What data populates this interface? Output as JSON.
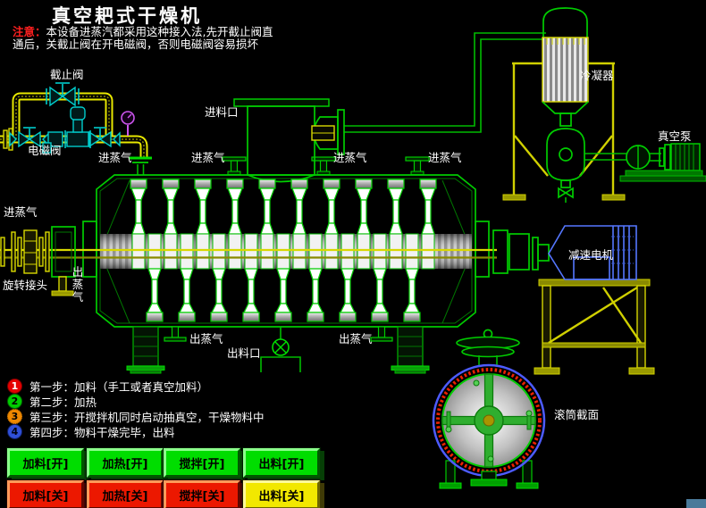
{
  "title": "真空耙式干燥机",
  "note": {
    "prefix": "注意：",
    "line1": "本设备进蒸汽都采用这种接入法,先开截止阀直",
    "line2": "通后，关截止阀在开电磁阀，否则电磁阀容易损坏"
  },
  "labels": {
    "stop_valve": "截止阀",
    "solenoid_valve": "电磁阀",
    "feed_inlet": "进料口",
    "steam_in": "进蒸气",
    "steam_out": "出蒸气",
    "rotary_joint": "旋转接头",
    "discharge_port": "出料口",
    "condenser": "冷凝器",
    "vacuum_pump": "真空泵",
    "gear_motor": "减速电机",
    "drum_section": "滚筒截面"
  },
  "steps": [
    {
      "num": "1",
      "badge_color": "#e60000",
      "text": "第一步：加料（手工或者真空加料）"
    },
    {
      "num": "2",
      "badge_color": "#00cc00",
      "text": "第二步：加热"
    },
    {
      "num": "3",
      "badge_color": "#ef8800",
      "text": "第三步：开搅拌机同时启动抽真空，干燥物料中"
    },
    {
      "num": "4",
      "badge_color": "#3050d8",
      "text": "第四步：物料干燥完毕，出料"
    }
  ],
  "buttons": {
    "on": [
      "加料[开]",
      "加热[开]",
      "搅拌[开]",
      "出料[开]"
    ],
    "off": [
      "加料[关]",
      "加热[关]",
      "搅拌[关]",
      "出料[关]"
    ]
  },
  "icons": {
    "stop_valve": "gate-valve-bowtie",
    "solenoid_valve": "solenoid-valve-with-actuator",
    "pressure_gauge": "circle-gauge",
    "discharge_valve": "circle-with-cross",
    "steam_tee": "tee-fitting",
    "drum_section": "circular-cross-section"
  },
  "colors": {
    "background": "#000000",
    "pipe_yellow": "#e8e800",
    "valve_cyan": "#00cccc",
    "equipment_green": "#00cc00",
    "motor_blue": "#5577ff",
    "gauge_magenta": "#cc55ee",
    "title_text": "#ffffff",
    "note_red": "#ff2020",
    "button_on": "#00dd00",
    "button_off": "#ec1800",
    "button_discharge_off": "#f2e800"
  }
}
